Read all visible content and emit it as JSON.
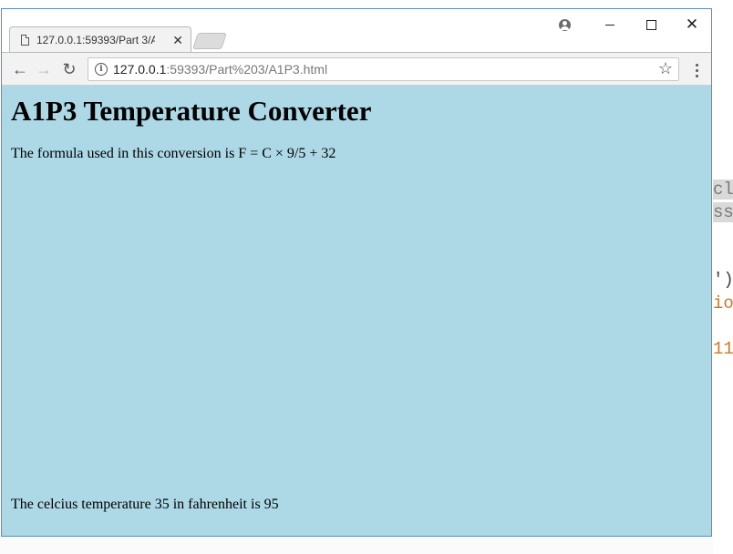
{
  "browser": {
    "tab_title": "127.0.0.1:59393/Part 3/A",
    "url_host": "127.0.0.1",
    "url_rest": ":59393/Part%203/A1P3.html"
  },
  "page": {
    "heading": "A1P3 Temperature Converter",
    "formula_text": "The formula used in this conversion is F = C × 9/5 + 32",
    "result_text": "The celcius temperature 35 in fahrenheit is 95",
    "background_color": "#add8e6"
  },
  "background_editor": {
    "lines": [
      "cl",
      "ss",
      "')",
      "io",
      "11"
    ]
  }
}
